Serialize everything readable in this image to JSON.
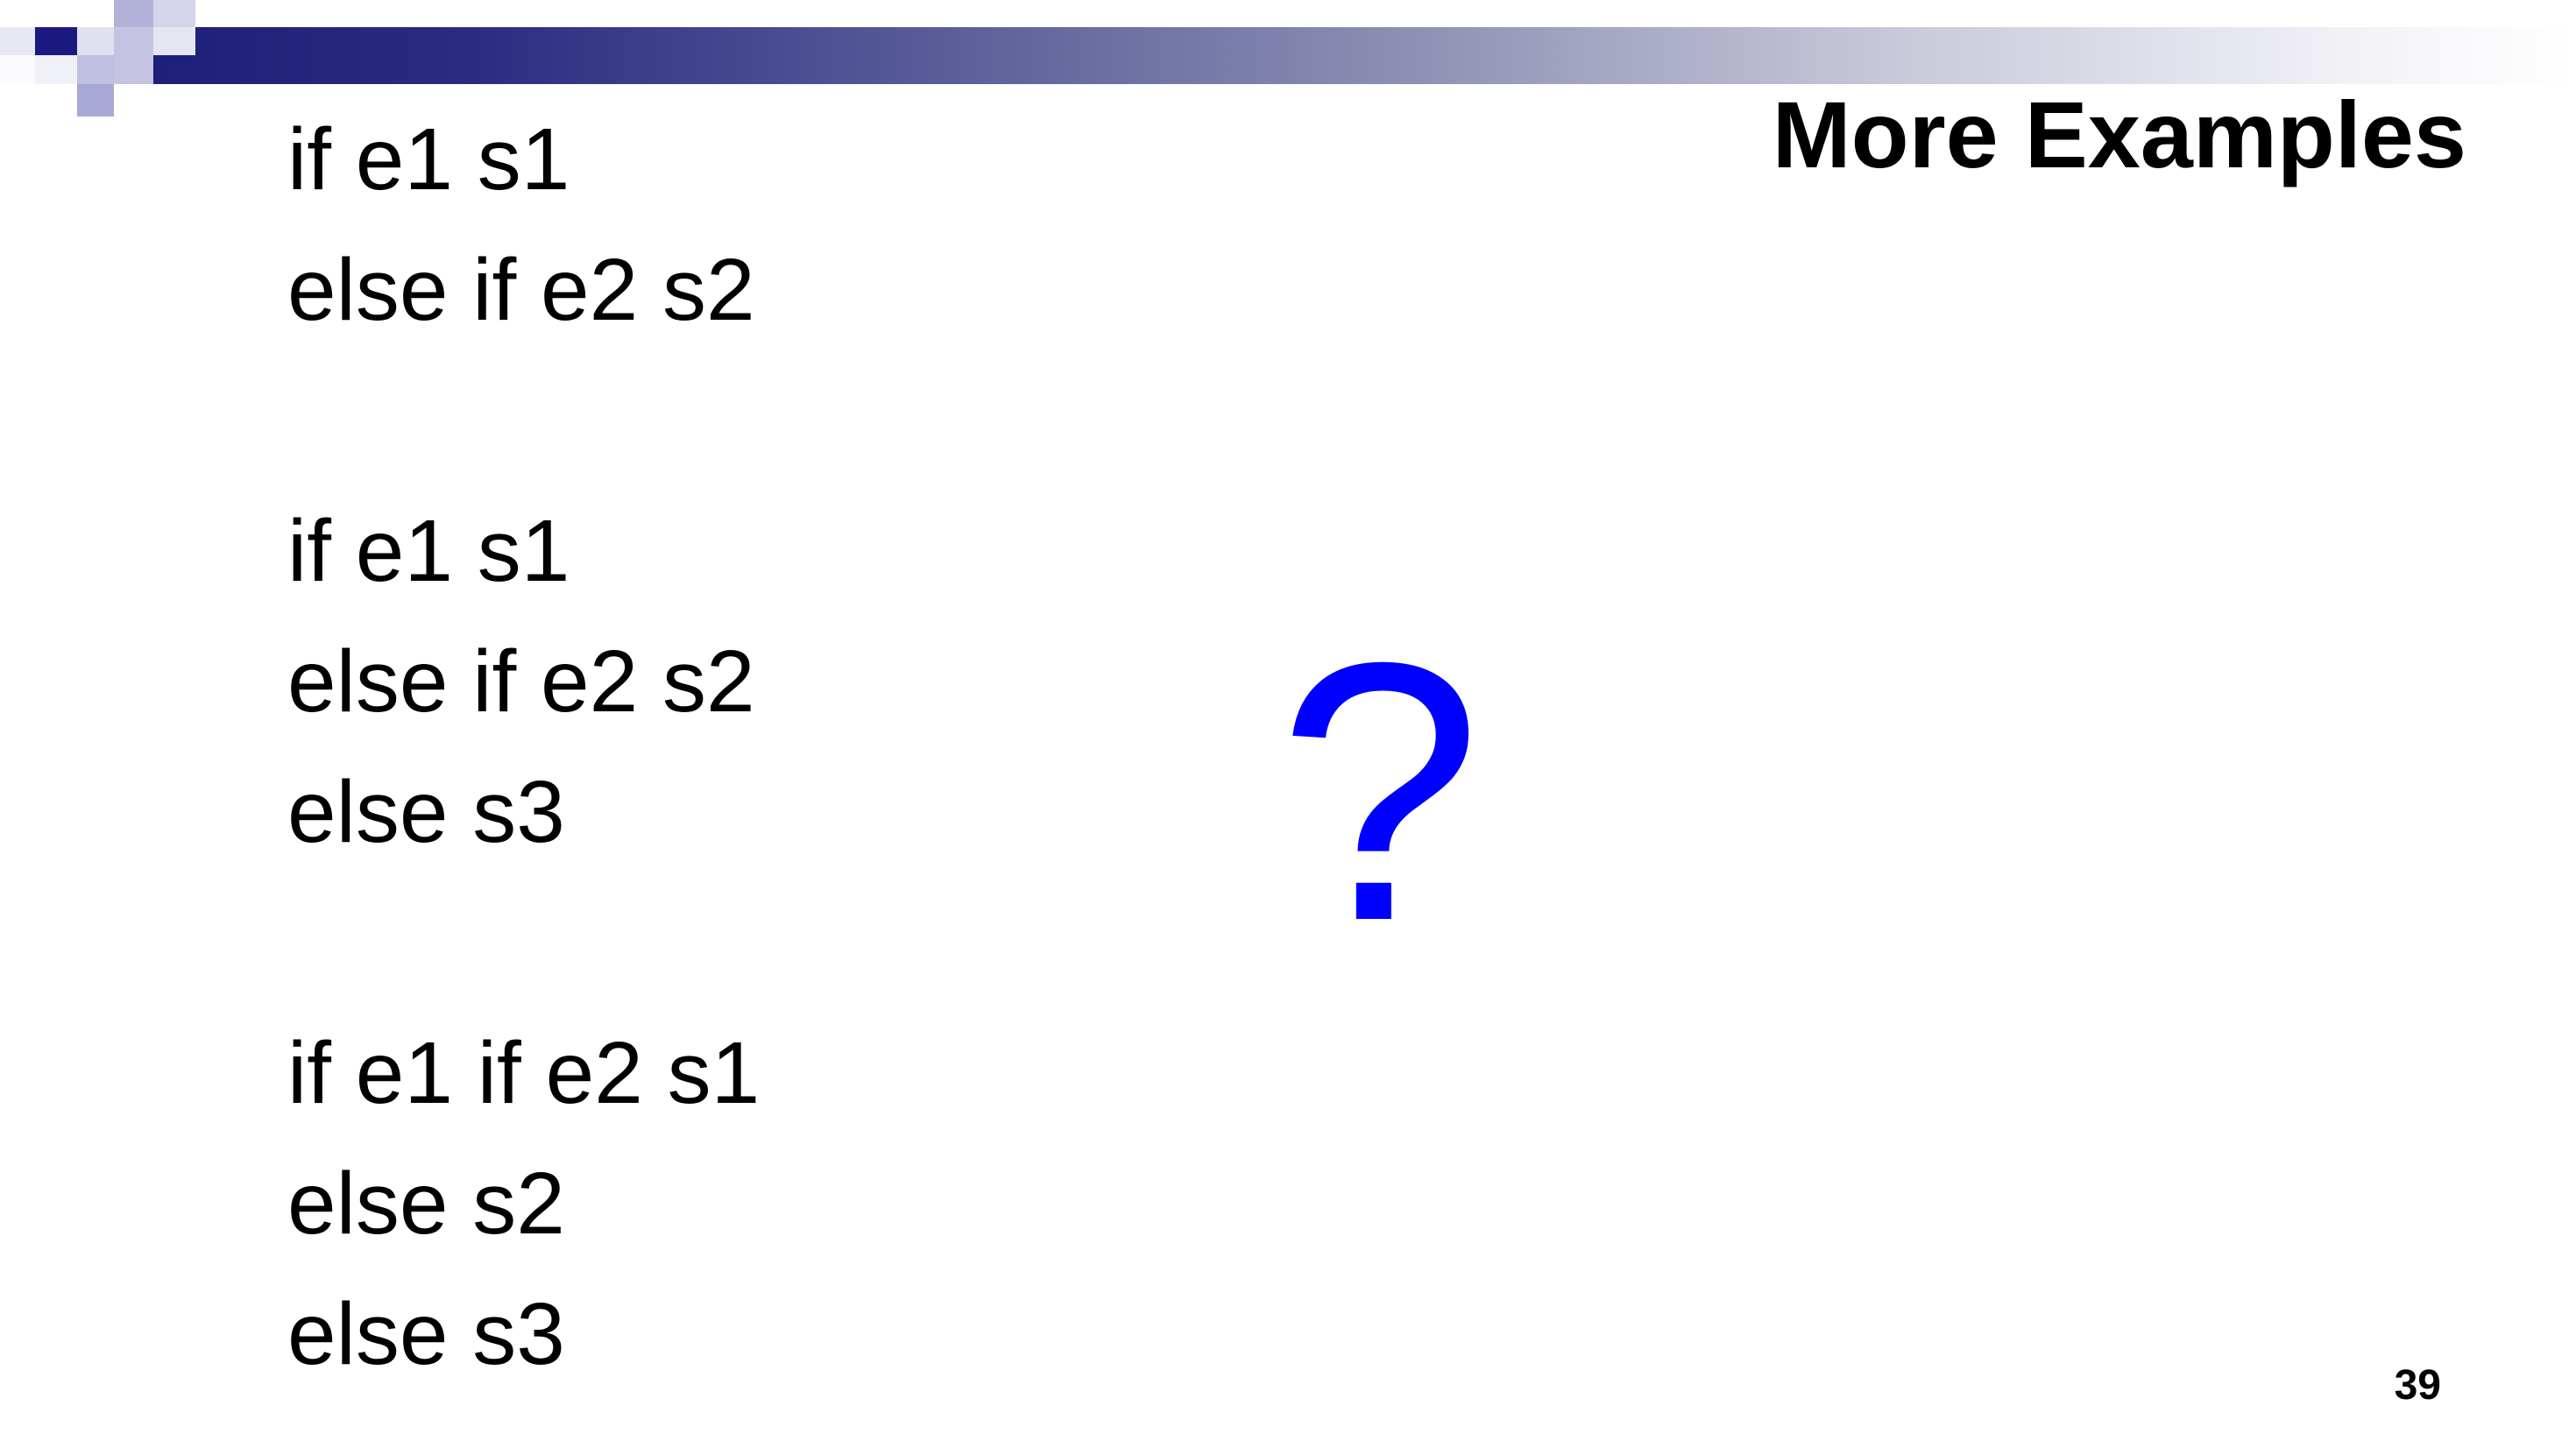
{
  "slide": {
    "title": "More Examples",
    "code_lines": [
      "if e1 s1",
      "else if e2 s2",
      "",
      "if e1 s1",
      "else if e2 s2",
      "else s3",
      "",
      "if e1 if e2 s1",
      "else s2",
      "else s3"
    ],
    "question_mark": "?",
    "page_number": "39"
  },
  "colors": {
    "accent": "#0000ff",
    "header_dark": "#1c1e78",
    "text": "#000000"
  }
}
